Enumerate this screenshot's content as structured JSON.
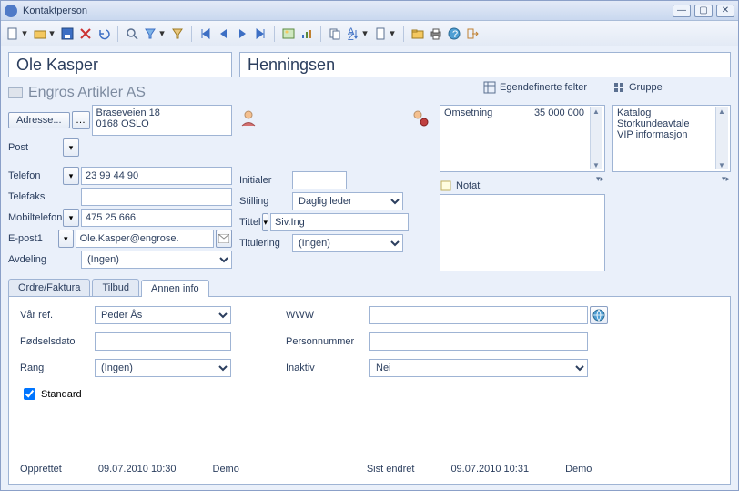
{
  "window": {
    "title": "Kontaktperson"
  },
  "name": {
    "first": "Ole Kasper",
    "last": "Henningsen"
  },
  "company": "Engros Artikler AS",
  "address": {
    "button": "Adresse...",
    "text": "Braseveien 18\n0168 OSLO",
    "post_label": "Post"
  },
  "contact": {
    "phone_label": "Telefon",
    "phone": "23 99 44 90",
    "fax_label": "Telefaks",
    "fax": "",
    "mobile_label": "Mobiltelefon",
    "mobile": "475 25 666",
    "email_label": "E-post1",
    "email": "Ole.Kasper@engrose.",
    "dept_label": "Avdeling",
    "dept": "(Ingen)"
  },
  "mid": {
    "initials_label": "Initialer",
    "initials": "",
    "position_label": "Stilling",
    "position": "Daglig leder",
    "title_label": "Tittel",
    "title": "Siv.Ing",
    "salutation_label": "Titulering",
    "salutation": "(Ingen)"
  },
  "custom": {
    "header": "Egendefinerte felter",
    "rows": [
      {
        "label": "Omsetning",
        "value": "35 000 000"
      }
    ]
  },
  "group": {
    "header": "Gruppe",
    "items": [
      "Katalog",
      "Storkundeavtale",
      "VIP informasjon"
    ]
  },
  "note": {
    "header": "Notat",
    "text": ""
  },
  "tabs": {
    "t1": "Ordre/Faktura",
    "t2": "Tilbud",
    "t3": "Annen info"
  },
  "other": {
    "ourref_label": "Vår ref.",
    "ourref": "Peder Ås",
    "birth_label": "Fødselsdato",
    "birth": "",
    "rank_label": "Rang",
    "rank": "(Ingen)",
    "standard_label": "Standard",
    "standard_checked": true,
    "www_label": "WWW",
    "www": "",
    "ssn_label": "Personnummer",
    "ssn": "",
    "inactive_label": "Inaktiv",
    "inactive": "Nei"
  },
  "audit": {
    "created_label": "Opprettet",
    "created_at": "09.07.2010 10:30",
    "created_by": "Demo",
    "modified_label": "Sist endret",
    "modified_at": "09.07.2010 10:31",
    "modified_by": "Demo"
  }
}
